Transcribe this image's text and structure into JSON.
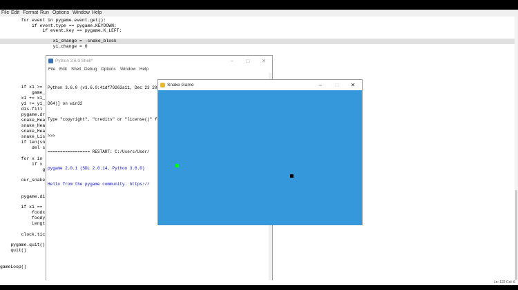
{
  "editor": {
    "menu": [
      "File",
      "Edit",
      "Format",
      "Run",
      "Options",
      "Window",
      "Help"
    ],
    "lines": [
      "        for event in pygame.event.get():",
      "            if event.type == pygame.KEYDOWN:",
      "                if event.key == pygame.K_LEFT:",
      "                    x1_change = -snake_block",
      "                    y1_change = 0",
      "        if x1 >=",
      "            game_",
      "        x1 += x1_",
      "        y1 += y1_",
      "        dis.fill",
      "        pygame.dr",
      "        snake_Hea",
      "        snake_Hea",
      "        snake_Hea",
      "        snake_Lis",
      "        if len(sn",
      "            del s",
      "        for x in",
      "            if x",
      "                g",
      "        our_snake",
      "        pygame.di",
      "        if x1 ==",
      "            foodx",
      "            foody",
      "            Lengt",
      "        clock.tic",
      "    pygame.quit()",
      "    quit()",
      "gameLoop()"
    ],
    "status": "Ln: 122  Col: 0"
  },
  "shell": {
    "title": "Python 3.6.0 Shell*",
    "menu": [
      "File",
      "Edit",
      "Shell",
      "Debug",
      "Options",
      "Window",
      "Help"
    ],
    "output": [
      "Python 3.6.0 (v3.6.0:41df79263a11, Dec 23 2016, 08:06:12) [MSC v.1900 64 bit (AM",
      "D64)] on win32",
      "Type \"copyright\", \"credits\" or \"license()\" for more information.",
      ">>> ",
      "================= RESTART: C:/Users/User/",
      "pygame 2.0.1 (SDL 2.0.14, Python 3.6.0)",
      "Hello from the pygame community. https://"
    ]
  },
  "snake_window": {
    "title": "Snake Game",
    "bg_color": "#3498db",
    "food_color": "#00ff00",
    "snake_color": "#000000"
  },
  "window_controls": {
    "minimize": "–",
    "maximize": "□",
    "close": "✕"
  }
}
